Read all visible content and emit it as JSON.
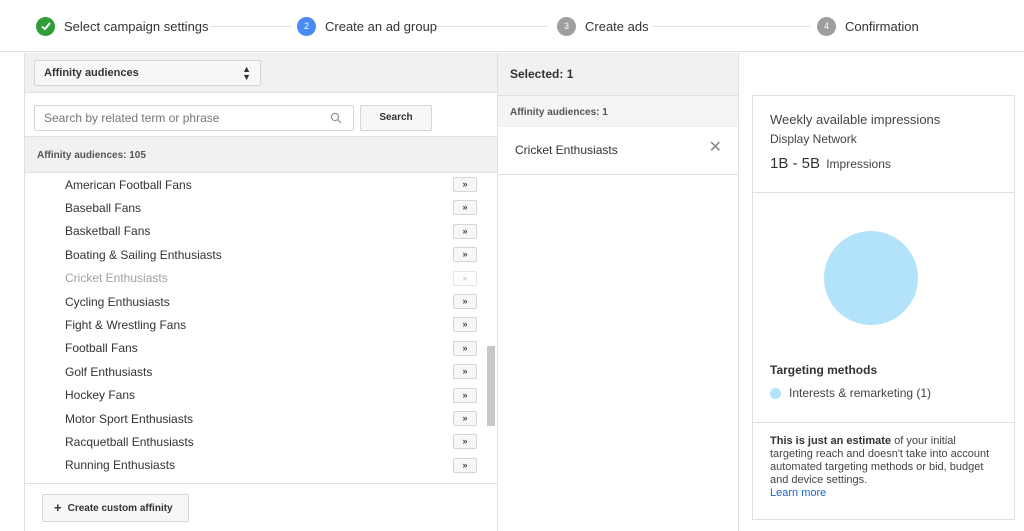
{
  "stepper": {
    "steps": [
      {
        "label": "Select campaign settings",
        "number": "",
        "state": "done"
      },
      {
        "label": "Create an ad group",
        "number": "2",
        "state": "active"
      },
      {
        "label": "Create ads",
        "number": "3",
        "state": "pending"
      },
      {
        "label": "Confirmation",
        "number": "4",
        "state": "pending"
      }
    ]
  },
  "left": {
    "dropdown_value": "Affinity audiences",
    "search_placeholder": "Search by related term or phrase",
    "search_button": "Search",
    "count_label": "Affinity audiences: 105",
    "add_symbol": "»",
    "items": [
      {
        "label": "American Football Fans",
        "disabled": false
      },
      {
        "label": "Baseball Fans",
        "disabled": false
      },
      {
        "label": "Basketball Fans",
        "disabled": false
      },
      {
        "label": "Boating & Sailing Enthusiasts",
        "disabled": false
      },
      {
        "label": "Cricket Enthusiasts",
        "disabled": true
      },
      {
        "label": "Cycling Enthusiasts",
        "disabled": false
      },
      {
        "label": "Fight & Wrestling Fans",
        "disabled": false
      },
      {
        "label": "Football Fans",
        "disabled": false
      },
      {
        "label": "Golf Enthusiasts",
        "disabled": false
      },
      {
        "label": "Hockey Fans",
        "disabled": false
      },
      {
        "label": "Motor Sport Enthusiasts",
        "disabled": false
      },
      {
        "label": "Racquetball Enthusiasts",
        "disabled": false
      },
      {
        "label": "Running Enthusiasts",
        "disabled": false
      }
    ],
    "create_button": "Create custom affinity"
  },
  "middle": {
    "header": "Selected: 1",
    "sub_header": "Affinity audiences: 1",
    "selected_items": [
      "Cricket Enthusiasts"
    ]
  },
  "right": {
    "title": "Weekly available impressions",
    "network": "Display Network",
    "range": "1B - 5B",
    "range_unit": "Impressions",
    "targeting_title": "Targeting methods",
    "targeting_item": "Interests & remarketing (1)",
    "estimate_bold": "This is just an estimate",
    "estimate_rest": " of your initial targeting reach and doesn't take into account automated targeting methods or bid, budget and device settings.",
    "learn_more": "Learn more",
    "colors": {
      "pie": "#b2e3fb",
      "link": "#1a66c9"
    }
  }
}
